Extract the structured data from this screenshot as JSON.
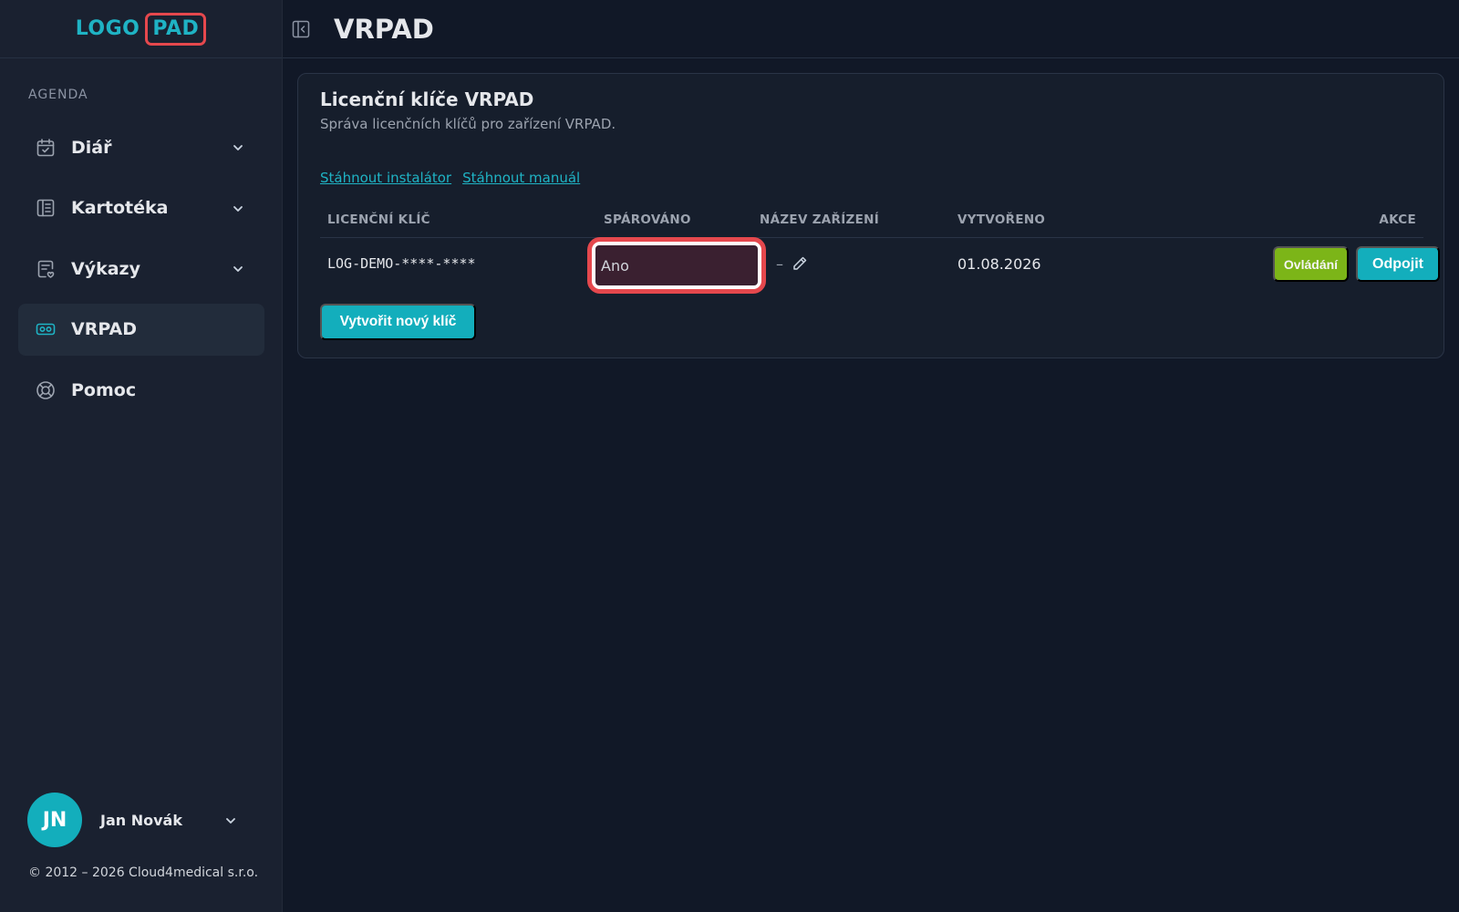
{
  "brand": {
    "logo_left": "LOGO",
    "logo_right": "PAD"
  },
  "sidebar": {
    "section_label": "AGENDA",
    "items": [
      {
        "label": "Diář",
        "icon": "calendar-check-icon",
        "has_submenu": true
      },
      {
        "label": "Kartotéka",
        "icon": "book-icon",
        "has_submenu": true
      },
      {
        "label": "Výkazy",
        "icon": "report-heart-icon",
        "has_submenu": true
      },
      {
        "label": "VRPAD",
        "icon": "vr-headset-icon",
        "has_submenu": false,
        "active": true
      },
      {
        "label": "Pomoc",
        "icon": "lifebuoy-icon",
        "has_submenu": false
      }
    ],
    "user": {
      "initials": "JN",
      "name": "Jan Novák"
    },
    "copyright": "© 2012 – 2026 Cloud4medical s.r.o."
  },
  "header": {
    "title": "VRPAD"
  },
  "card": {
    "title": "Licenční klíče VRPAD",
    "subtitle": "Správa licenčních klíčů pro zařízení VRPAD.",
    "links": {
      "installer": "Stáhnout instalátor",
      "manual": "Stáhnout manuál"
    },
    "table": {
      "headers": {
        "key": "LICENČNÍ KLÍČ",
        "paired": "SPÁROVÁNO",
        "device": "NÁZEV ZAŘÍZENÍ",
        "created": "VYTVOŘENO",
        "actions": "AKCE"
      },
      "rows": [
        {
          "key": "LOG-DEMO-****-****",
          "paired": "Ano",
          "device": "–",
          "created": "01.08.2026",
          "btn_control": "Ovládání",
          "btn_disconnect": "Odpojit"
        }
      ]
    },
    "new_key_button": "Vytvořit nový klíč"
  },
  "colors": {
    "accent": "#13aebc",
    "control_button": "#7cb518",
    "highlight": "#e5484d",
    "background": "#111827",
    "sidebar": "#1a2130"
  }
}
